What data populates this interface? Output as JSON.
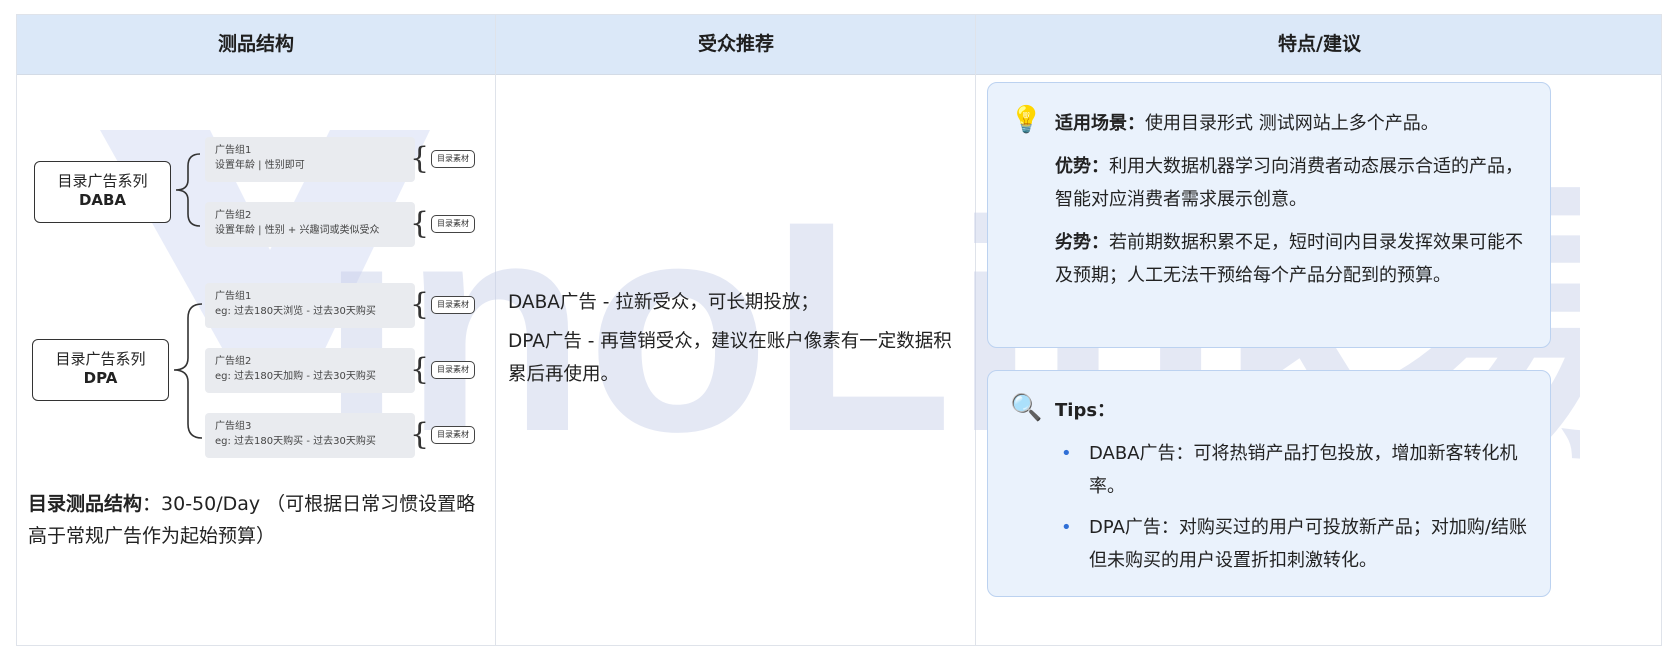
{
  "header": {
    "col1": "测品结构",
    "col2": "受众推荐",
    "col3": "特点/建议"
  },
  "mindmap": {
    "daba": {
      "line1": "目录广告系列",
      "line2": "DABA",
      "groups": [
        {
          "title": "广告组1",
          "desc": "设置年龄 | 性别即可",
          "chip": "目录素材"
        },
        {
          "title": "广告组2",
          "desc": "设置年龄 | 性别 + 兴趣词或类似受众",
          "chip": "目录素材"
        }
      ]
    },
    "dpa": {
      "line1": "目录广告系列",
      "line2": "DPA",
      "groups": [
        {
          "title": "广告组1",
          "desc": "eg: 过去180天浏览 - 过去30天购买",
          "chip": "目录素材"
        },
        {
          "title": "广告组2",
          "desc": "eg: 过去180天加购 - 过去30天购买",
          "chip": "目录素材"
        },
        {
          "title": "广告组3",
          "desc": "eg: 过去180天购买 - 过去30天购买",
          "chip": "目录素材"
        }
      ]
    }
  },
  "left_note": {
    "label": "目录测品结构",
    "text": "：30-50/Day （可根据日常习惯设置略高于常规广告作为起始预算）"
  },
  "audience": {
    "p1": "DABA广告 - 拉新受众，可长期投放；",
    "p2": "DPA广告 - 再营销受众，建议在账户像素有一定数据积累后再使用。"
  },
  "features": {
    "scene_label": "适用场景：",
    "scene_text": "使用目录形式 测试网站上多个产品。",
    "adv_label": "优势：",
    "adv_text": "利用大数据机器学习向消费者动态展示合适的产品，智能对应消费者需求展示创意。",
    "dis_label": "劣势：",
    "dis_text": "若前期数据积累不足，短时间内目录发挥效果可能不及预期；人工无法干预给每个产品分配到的预算。"
  },
  "tips": {
    "title": "Tips：",
    "items": [
      "DABA广告：可将热销产品打包投放，增加新客转化机率。",
      "DPA广告：对购买过的用户可投放新产品；对加购/结账但未购买的用户设置折扣刺激转化。"
    ]
  },
  "watermark": "inoLink易诺"
}
